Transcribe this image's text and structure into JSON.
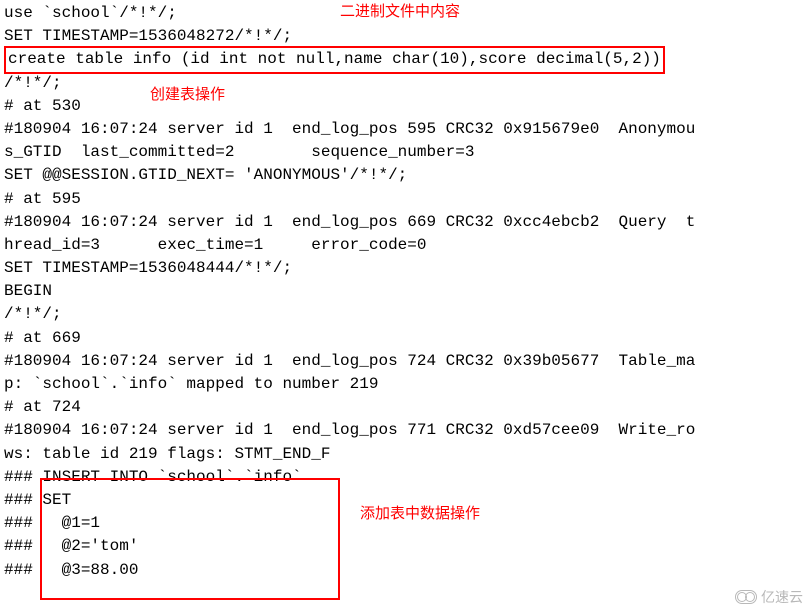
{
  "annotations": {
    "binary_content": "二进制文件中内容",
    "create_table_op": "创建表操作",
    "insert_data_op": "添加表中数据操作"
  },
  "lines": {
    "l01": "use `school`/*!*/;",
    "l02": "SET TIMESTAMP=1536048272/*!*/;",
    "l03": "create table info (id int not null,name char(10),score decimal(5,2))",
    "l04": "/*!*/;",
    "l05": "# at 530",
    "l06": "#180904 16:07:24 server id 1  end_log_pos 595 CRC32 0x915679e0  Anonymou",
    "l07": "s_GTID  last_committed=2        sequence_number=3",
    "l08": "SET @@SESSION.GTID_NEXT= 'ANONYMOUS'/*!*/;",
    "l09": "# at 595",
    "l10": "#180904 16:07:24 server id 1  end_log_pos 669 CRC32 0xcc4ebcb2  Query  t",
    "l11": "hread_id=3      exec_time=1     error_code=0",
    "l12": "SET TIMESTAMP=1536048444/*!*/;",
    "l13": "BEGIN",
    "l14": "/*!*/;",
    "l15": "# at 669",
    "l16": "#180904 16:07:24 server id 1  end_log_pos 724 CRC32 0x39b05677  Table_ma",
    "l17": "p: `school`.`info` mapped to number 219",
    "l18": "# at 724",
    "l19": "#180904 16:07:24 server id 1  end_log_pos 771 CRC32 0xd57cee09  Write_ro",
    "l20": "ws: table id 219 flags: STMT_END_F",
    "l21": "### INSERT INTO `school`.`info`",
    "l22": "### SET",
    "l23": "###   @1=1",
    "l24": "###   @2='tom'",
    "l25": "###   @3=88.00"
  },
  "watermark": "亿速云"
}
